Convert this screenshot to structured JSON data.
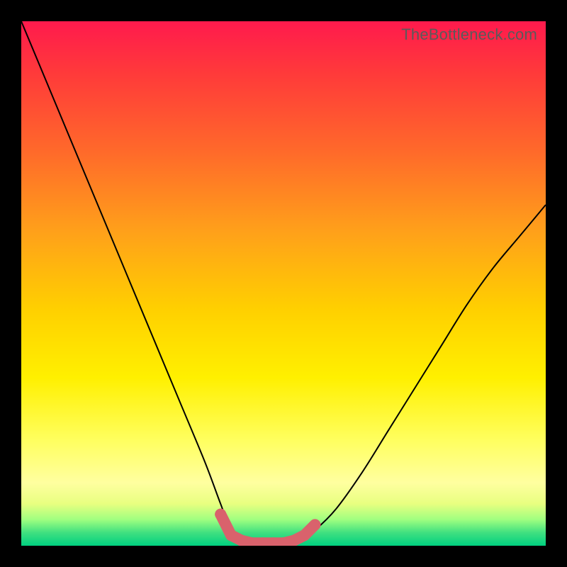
{
  "watermark": "TheBottleneck.com",
  "chart_data": {
    "type": "line",
    "title": "",
    "xlabel": "",
    "ylabel": "",
    "xlim": [
      0,
      100
    ],
    "ylim": [
      0,
      100
    ],
    "grid": false,
    "series": [
      {
        "name": "bottleneck-curve",
        "x": [
          0,
          5,
          10,
          15,
          20,
          25,
          30,
          35,
          38,
          40,
          42,
          44,
          46,
          48,
          50,
          53,
          56,
          60,
          65,
          70,
          75,
          80,
          85,
          90,
          95,
          100
        ],
        "values": [
          100,
          88,
          76,
          64,
          52,
          40,
          28,
          16,
          8,
          3,
          1,
          0,
          0,
          0,
          0,
          1,
          3,
          7,
          14,
          22,
          30,
          38,
          46,
          53,
          59,
          65
        ]
      },
      {
        "name": "highlight-dots",
        "x": [
          38,
          40,
          42,
          44,
          46,
          48,
          50,
          52,
          54,
          56
        ],
        "values": [
          6,
          2,
          1,
          0.5,
          0.5,
          0.5,
          0.5,
          1,
          2,
          4
        ]
      }
    ],
    "colors": {
      "curve": "#000000",
      "dots": "#d9626c"
    }
  }
}
